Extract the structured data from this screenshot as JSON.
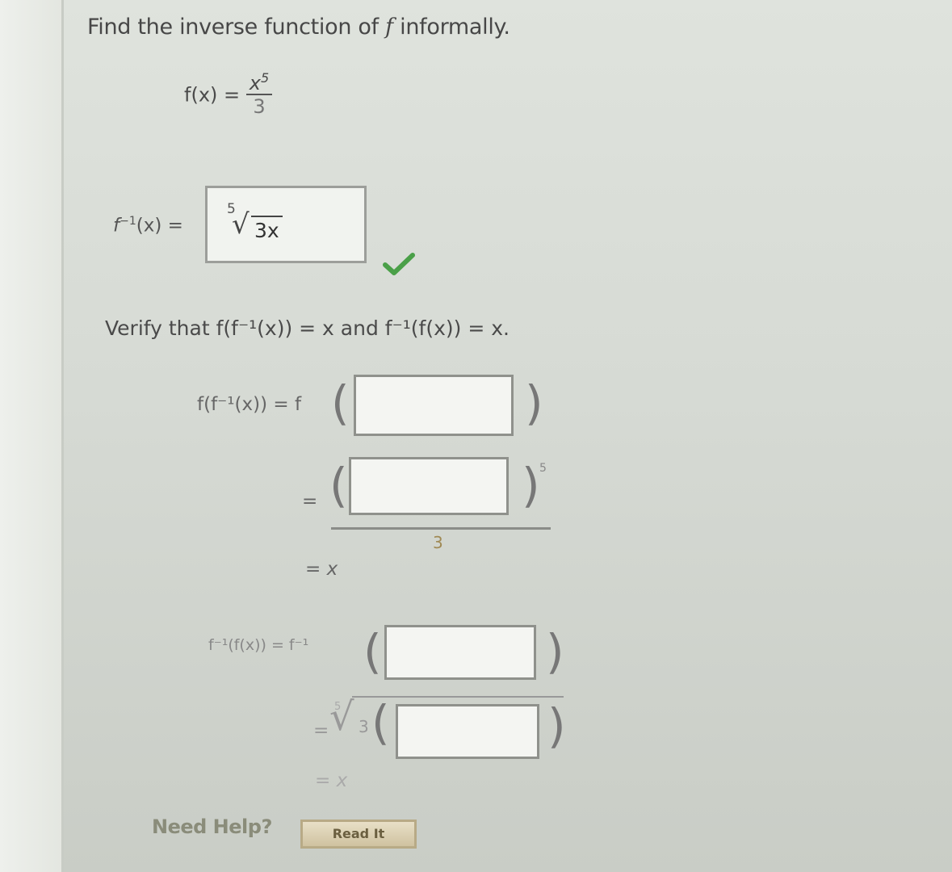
{
  "question": {
    "title_prefix": "Find the inverse function of ",
    "title_var": "f",
    "title_suffix": " informally."
  },
  "given": {
    "lhs": "f(x) =",
    "numerator": "x",
    "exponent": "5",
    "denominator": "3"
  },
  "inverse_answer": {
    "label": "f",
    "label_sup": "−1",
    "label_tail": "(x) =",
    "root_index": "5",
    "radicand": "3x",
    "status": "correct"
  },
  "verify": {
    "text": "Verify that f(f⁻¹(x)) = x and f⁻¹(f(x)) = x."
  },
  "step1": {
    "lhs": "f(f⁻¹(x)) = f",
    "input1_value": "",
    "eq2": "=",
    "input2_value": "",
    "exponent": "5",
    "denominator": "3",
    "result": "= x"
  },
  "step2": {
    "lhs": "f⁻¹(f(x)) = f⁻¹",
    "input1_value": "",
    "eq2": "=",
    "root_index": "5",
    "radicand_coef": "3",
    "input2_value": "",
    "result": "= x"
  },
  "footer": {
    "need_help": "Need Help?",
    "read_button": "Read It"
  },
  "colors": {
    "check": "#4aa048",
    "box_border": "#8f918c"
  }
}
